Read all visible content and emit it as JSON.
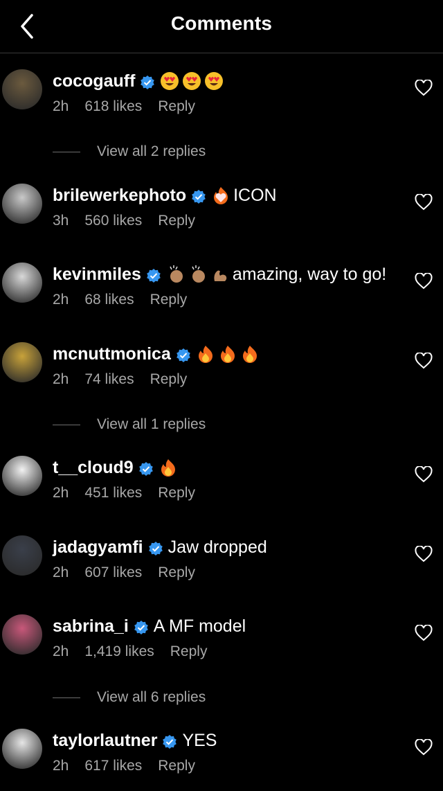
{
  "header": {
    "title": "Comments"
  },
  "comments": [
    {
      "user": "cocogauff",
      "text": "",
      "emoji": [
        "heart-eyes",
        "heart-eyes",
        "heart-eyes"
      ],
      "time": "2h",
      "likes": "618 likes",
      "reply": "Reply",
      "replies": "View all 2 replies",
      "avatar_color": "#6b5a3e"
    },
    {
      "user": "brilewerkephoto",
      "text": "ICON",
      "emoji": [
        "heart-on-fire"
      ],
      "time": "3h",
      "likes": "560 likes",
      "reply": "Reply",
      "replies": "",
      "avatar_color": "#c9c9c9"
    },
    {
      "user": "kevinmiles",
      "text": "amazing, way to go!",
      "emoji": [
        "clap",
        "clap",
        "flex"
      ],
      "time": "2h",
      "likes": "68 likes",
      "reply": "Reply",
      "replies": "",
      "avatar_color": "#d8d8d8"
    },
    {
      "user": "mcnuttmonica",
      "text": "",
      "emoji": [
        "fire",
        "fire",
        "fire"
      ],
      "time": "2h",
      "likes": "74 likes",
      "reply": "Reply",
      "replies": "View all 1 replies",
      "avatar_color": "#c8a23a"
    },
    {
      "user": "t__cloud9",
      "text": "",
      "emoji": [
        "fire"
      ],
      "time": "2h",
      "likes": "451 likes",
      "reply": "Reply",
      "replies": "",
      "avatar_color": "#f2f2f2"
    },
    {
      "user": "jadagyamfi",
      "text": "Jaw dropped",
      "emoji": [],
      "time": "2h",
      "likes": "607 likes",
      "reply": "Reply",
      "replies": "",
      "avatar_color": "#3a3f4a"
    },
    {
      "user": "sabrina_i",
      "text": "A MF model",
      "emoji": [],
      "time": "2h",
      "likes": "1,419 likes",
      "reply": "Reply",
      "replies": "View all 6 replies",
      "avatar_color": "#c8587a"
    },
    {
      "user": "taylorlautner",
      "text": "YES",
      "emoji": [],
      "time": "2h",
      "likes": "617 likes",
      "reply": "Reply",
      "replies": "",
      "avatar_color": "#e6e6e6"
    }
  ],
  "colors": {
    "verified": "#3797f0",
    "secondary_text": "#a8a8a8",
    "background": "#000000"
  }
}
